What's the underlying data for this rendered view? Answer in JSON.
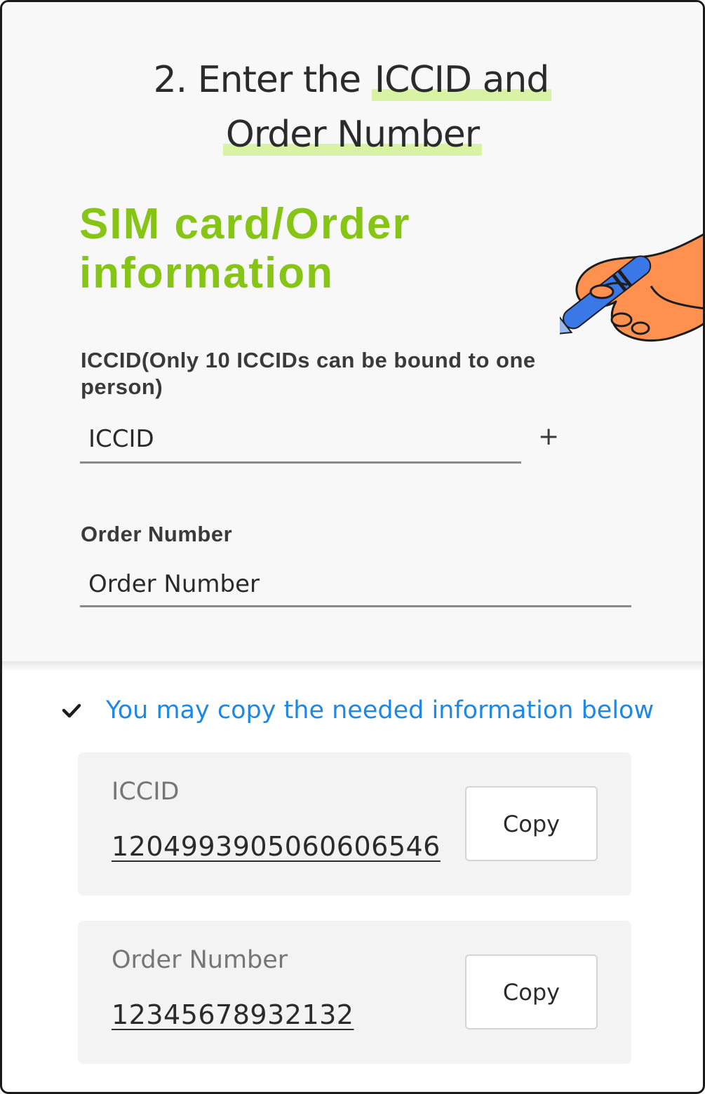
{
  "header": {
    "title_line1_plain": "2. Enter the ",
    "title_line1_highlight": "ICCID and",
    "title_line2_highlight": "Order Number",
    "highlight_color": "#d8f3a3"
  },
  "form": {
    "section_title": "SIM card/Order information",
    "accent_color": "#86c516",
    "iccid_label": "ICCID(Only 10 ICCIDs can be bound to one person)",
    "iccid_placeholder": "ICCID",
    "add_symbol": "+",
    "order_label": "Order Number",
    "order_placeholder": "Order Number",
    "illustration": "hand-holding-pen-icon"
  },
  "copy_section": {
    "hint_icon": "check-icon",
    "hint_text": "You may copy the needed information below",
    "hint_color": "#1e88e5",
    "items": [
      {
        "label": "ICCID",
        "value": "1204993905060606546",
        "button_label": "Copy"
      },
      {
        "label": "Order Number",
        "value": "12345678932132",
        "button_label": "Copy"
      }
    ]
  }
}
